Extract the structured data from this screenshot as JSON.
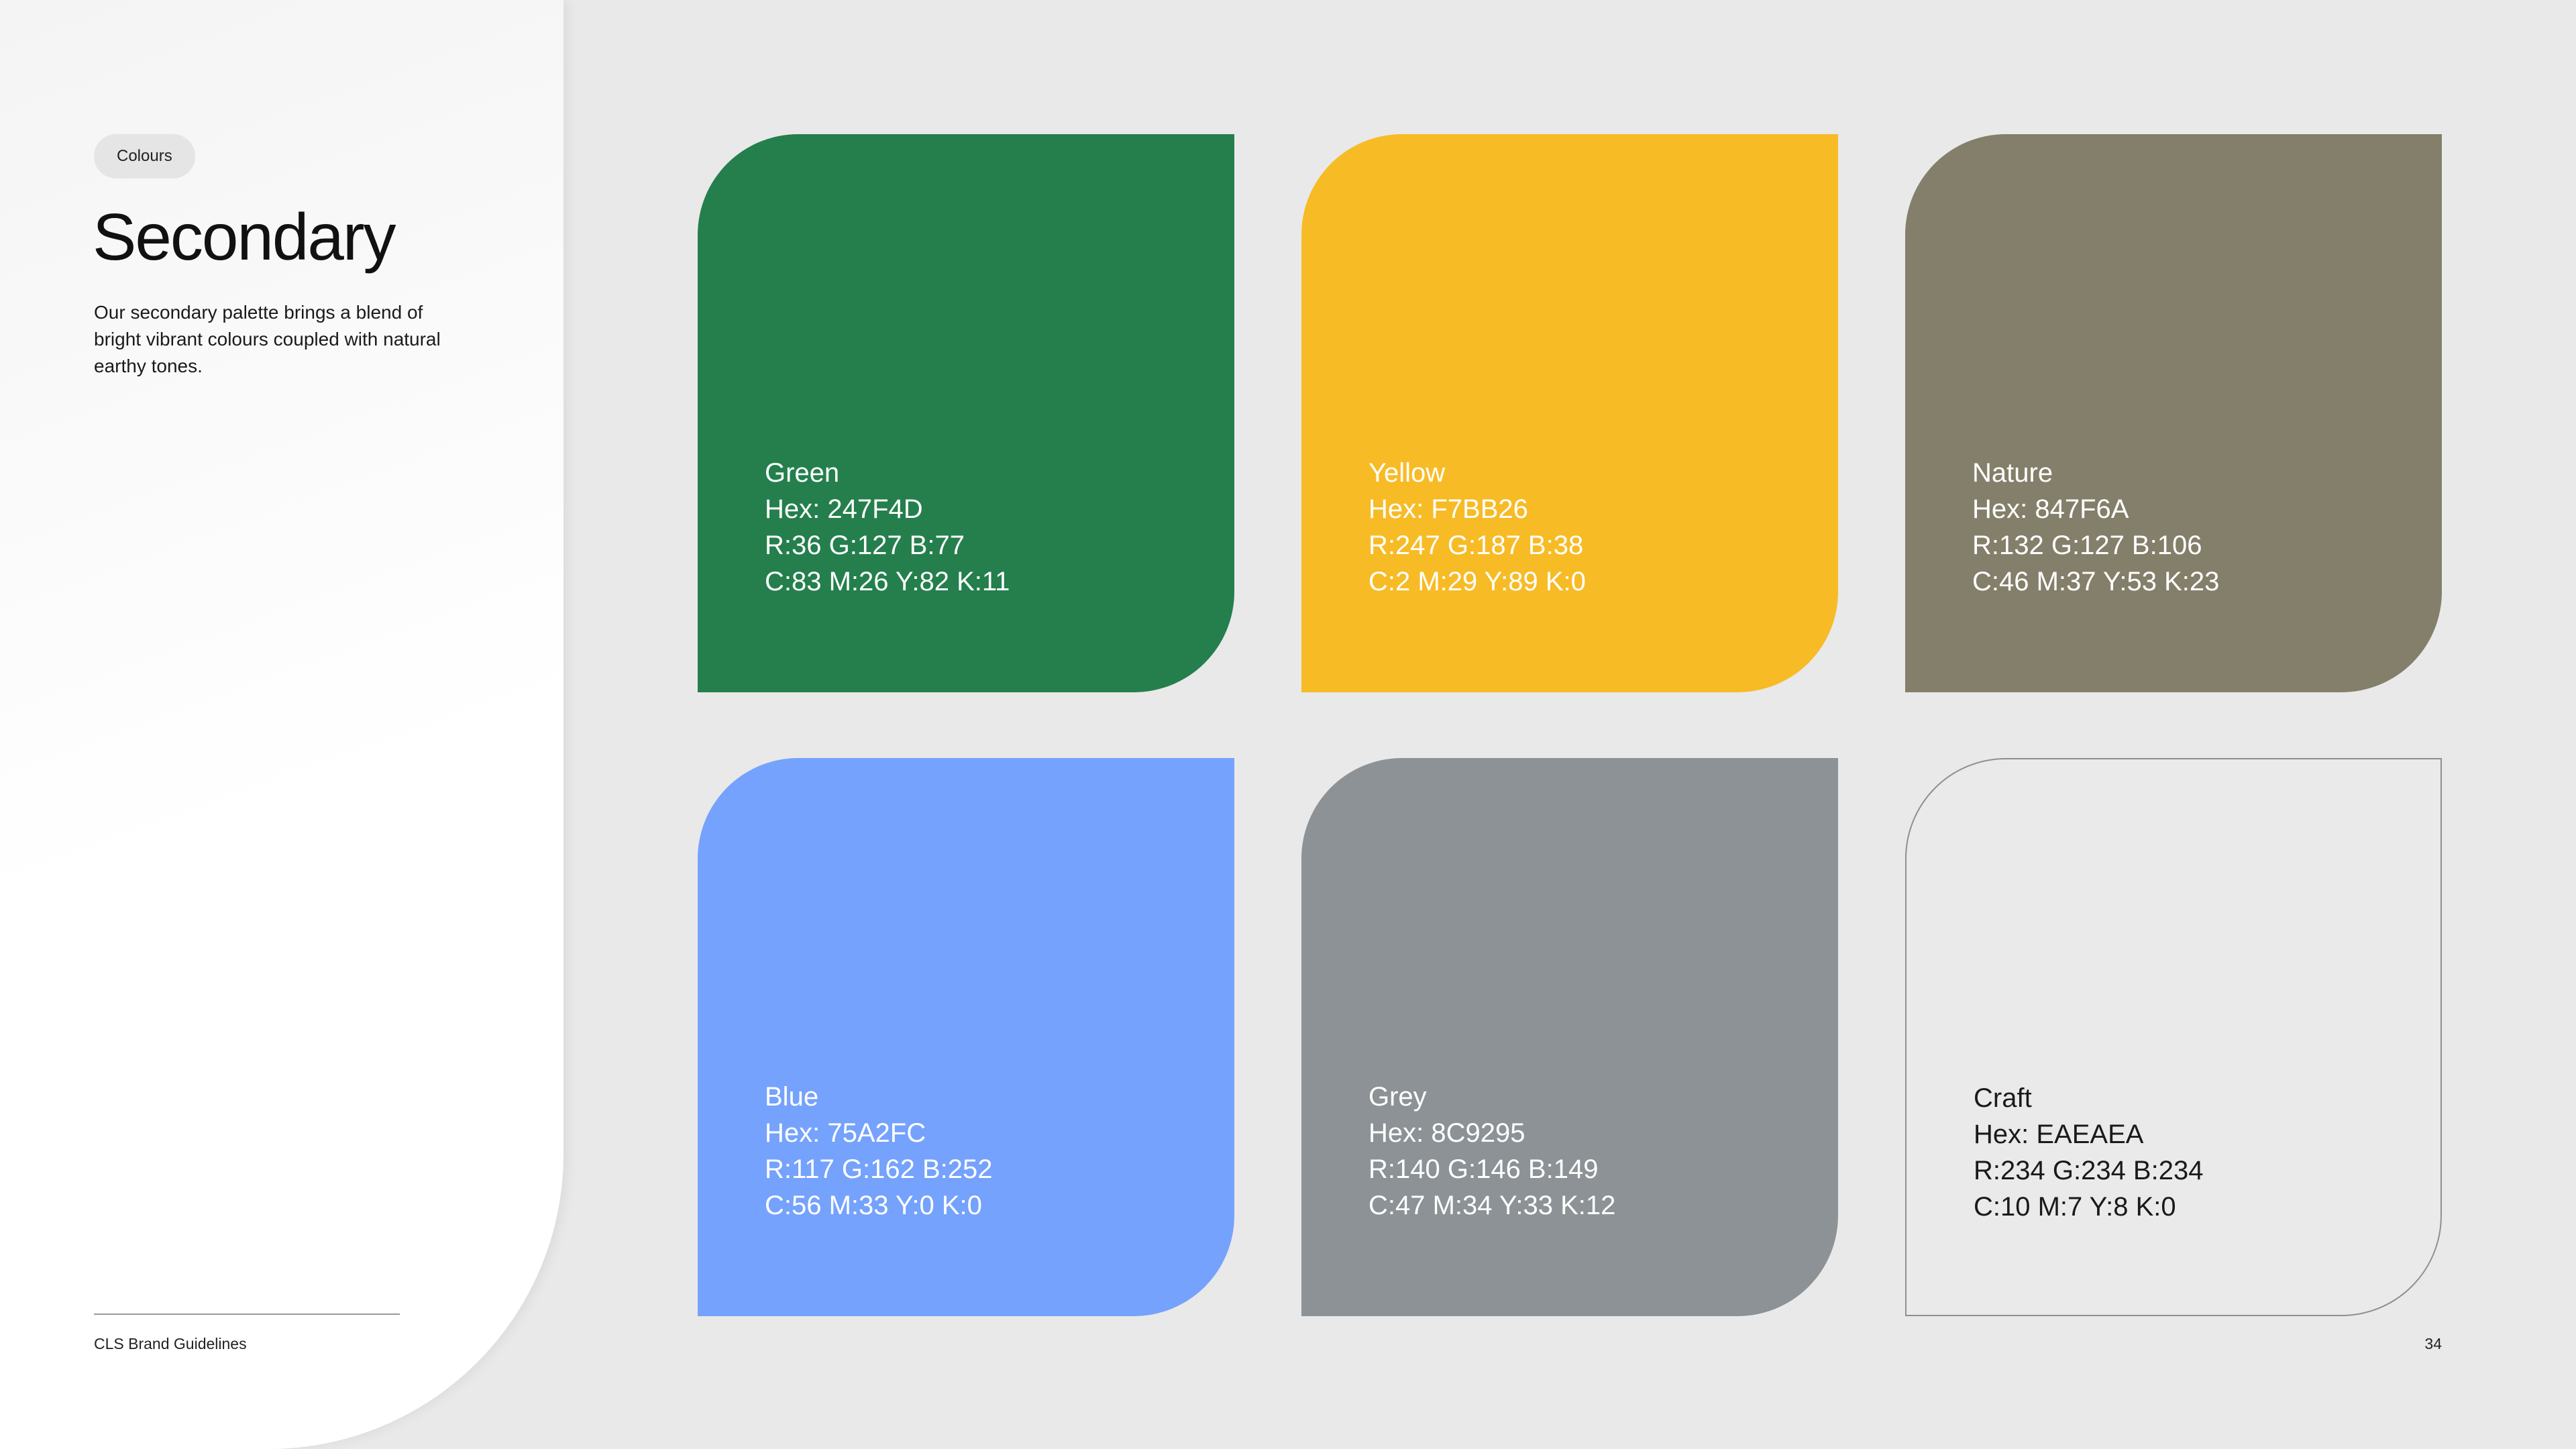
{
  "section_tag": "Colours",
  "title": "Secondary",
  "description": "Our secondary palette brings a blend of bright vibrant colours coupled with natural earthy tones.",
  "footer": {
    "brand": "CLS Brand Guidelines",
    "page_number": "34"
  },
  "swatches": [
    {
      "name": "Green",
      "hex_line": "Hex: 247F4D",
      "rgb_line": "R:36  G:127  B:77",
      "cmyk_line": "C:83  M:26  Y:82  K:11",
      "color": "#247F4D"
    },
    {
      "name": "Yellow",
      "hex_line": "Hex: F7BB26",
      "rgb_line": "R:247  G:187  B:38",
      "cmyk_line": "C:2  M:29  Y:89  K:0",
      "color": "#F7BB26"
    },
    {
      "name": "Nature",
      "hex_line": "Hex: 847F6A",
      "rgb_line": "R:132  G:127  B:106",
      "cmyk_line": "C:46  M:37  Y:53  K:23",
      "color": "#847F6A"
    },
    {
      "name": "Blue",
      "hex_line": "Hex: 75A2FC",
      "rgb_line": "R:117  G:162  B:252",
      "cmyk_line": "C:56  M:33  Y:0  K:0",
      "color": "#75A2FC"
    },
    {
      "name": "Grey",
      "hex_line": "Hex: 8C9295",
      "rgb_line": "R:140  G:146  B:149",
      "cmyk_line": "C:47  M:34  Y:33  K:12",
      "color": "#8C9295"
    },
    {
      "name": "Craft",
      "hex_line": "Hex: EAEAEA",
      "rgb_line": "R:234  G:234  B:234",
      "cmyk_line": "C:10  M:7  Y:8  K:0",
      "color": "#EAEAEA"
    }
  ]
}
